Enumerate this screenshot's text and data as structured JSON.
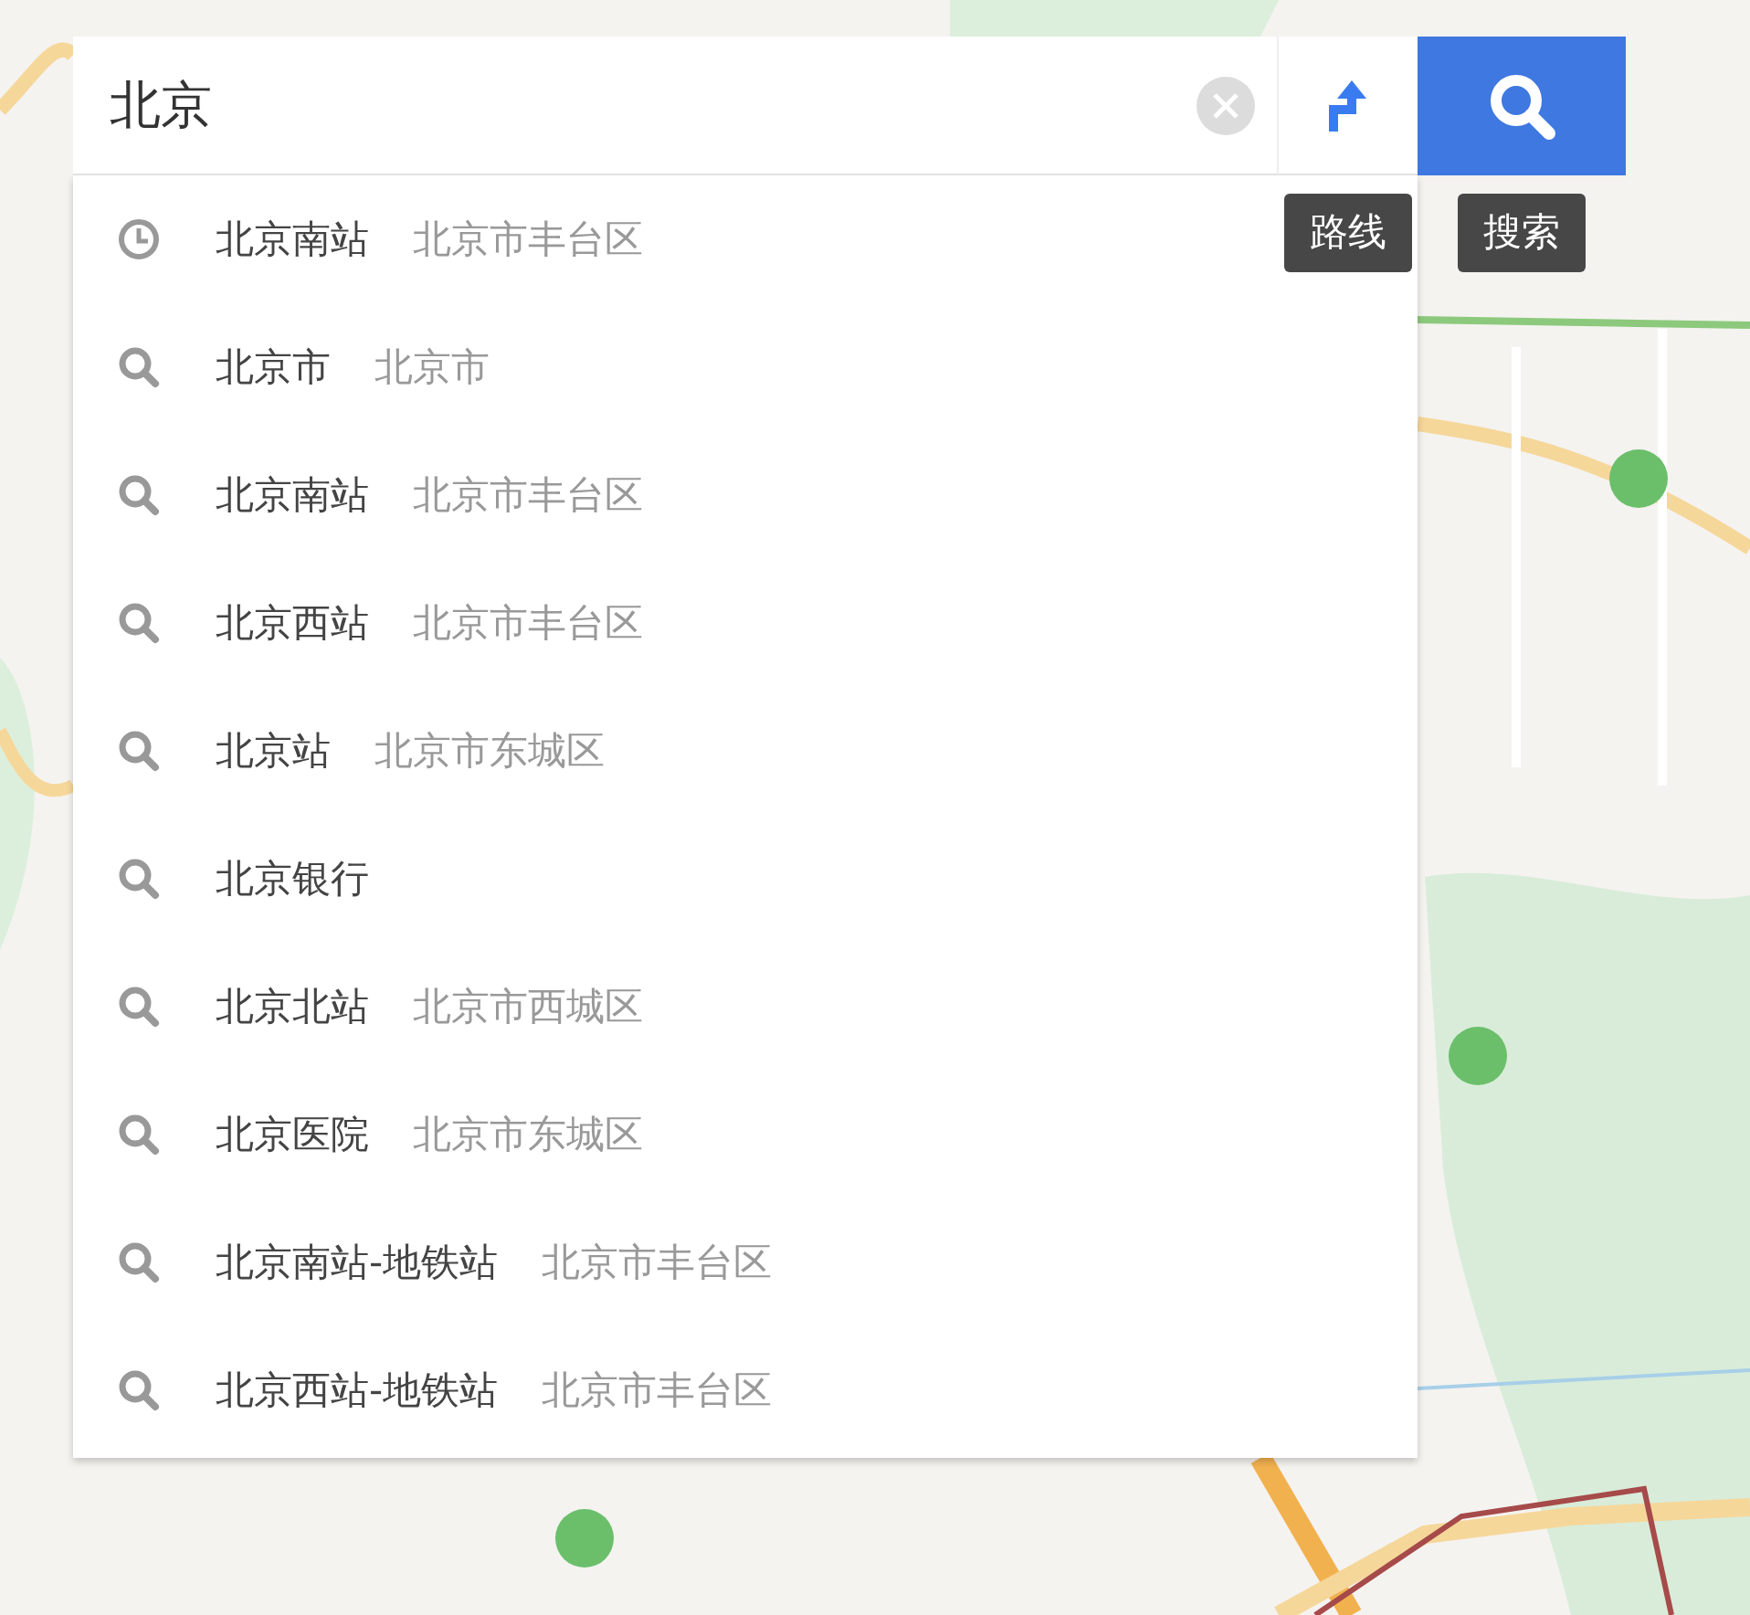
{
  "search": {
    "value": "北京"
  },
  "route_button": {
    "tooltip": "路线"
  },
  "search_button": {
    "tooltip": "搜索"
  },
  "suggestions": [
    {
      "kind": "history",
      "name": "北京南站",
      "district": "北京市丰台区"
    },
    {
      "kind": "search",
      "name": "北京市",
      "district": "北京市"
    },
    {
      "kind": "search",
      "name": "北京南站",
      "district": "北京市丰台区"
    },
    {
      "kind": "search",
      "name": "北京西站",
      "district": "北京市丰台区"
    },
    {
      "kind": "search",
      "name": "北京站",
      "district": "北京市东城区"
    },
    {
      "kind": "search",
      "name": "北京银行"
    },
    {
      "kind": "search",
      "name": "北京北站",
      "district": "北京市西城区"
    },
    {
      "kind": "search",
      "name": "北京医院",
      "district": "北京市东城区"
    },
    {
      "kind": "search",
      "name": "北京南站-地铁站",
      "district": "北京市丰台区"
    },
    {
      "kind": "search",
      "name": "北京西站-地铁站",
      "district": "北京市丰台区"
    }
  ]
}
